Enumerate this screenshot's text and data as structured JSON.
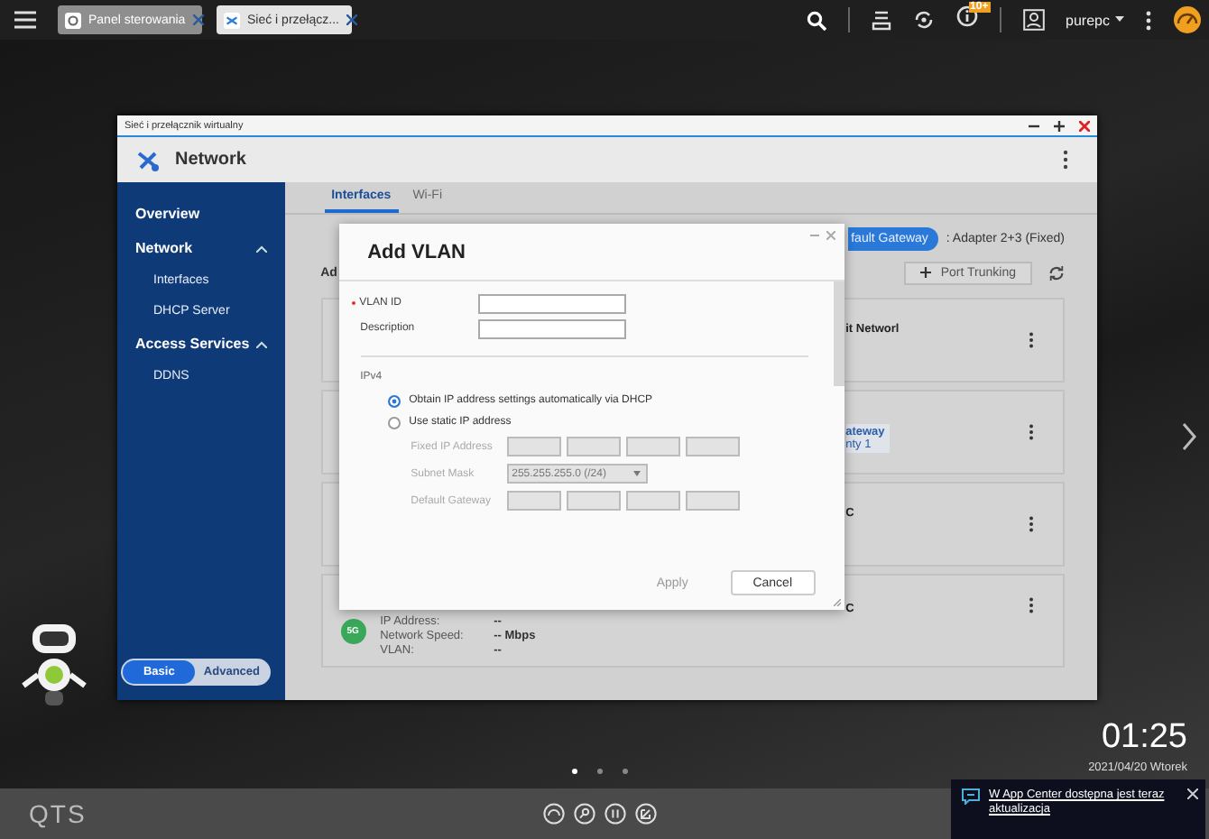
{
  "top_bar": {
    "tabs": [
      {
        "label": "Panel sterowania",
        "selected": false
      },
      {
        "label": "Sieć i przełącz...",
        "selected": true
      }
    ],
    "notification_badge": "10+",
    "user": "purepc"
  },
  "window": {
    "title": "Sieć i przełącznik wirtualny",
    "app_title": "Network"
  },
  "sidebar": {
    "items": [
      {
        "label": "Overview"
      },
      {
        "label": "Network",
        "expanded": true,
        "children": [
          {
            "label": "Interfaces"
          },
          {
            "label": "DHCP Server"
          }
        ]
      },
      {
        "label": "Access Services",
        "expanded": true,
        "children": [
          {
            "label": "DDNS"
          }
        ]
      }
    ],
    "mode_toggle": [
      {
        "label": "Basic",
        "selected": true
      },
      {
        "label": "Advanced",
        "selected": false
      }
    ]
  },
  "content": {
    "tabs": [
      {
        "label": "Interfaces",
        "selected": true
      },
      {
        "label": "Wi-Fi",
        "selected": false
      }
    ],
    "gateway_pill": "fault Gateway",
    "gateway_value": ": Adapter 2+3 (Fixed)",
    "section_fragment": "Ad",
    "port_trunking_button": "Port Trunking",
    "cards": [
      {
        "kind": "title",
        "fragment": "it Networl"
      },
      {
        "kind": "tag",
        "tag_lines": [
          "ateway",
          "nty 1"
        ]
      },
      {
        "kind": "title",
        "fragment": "C"
      },
      {
        "kind": "title",
        "fragment": "C",
        "badge": "5G",
        "details": [
          {
            "label": "IP Address:",
            "value": "--"
          },
          {
            "label": "Network Speed:",
            "value": "-- Mbps"
          },
          {
            "label": "VLAN:",
            "value": "--"
          }
        ]
      }
    ]
  },
  "dialog": {
    "title": "Add VLAN",
    "fields": [
      {
        "label": "VLAN ID",
        "required": true
      },
      {
        "label": "Description",
        "required": false
      }
    ],
    "section": "IPv4",
    "options": [
      {
        "label": "Obtain IP address settings automatically via DHCP",
        "selected": true
      },
      {
        "label": "Use static IP address",
        "selected": false
      }
    ],
    "static_rows": [
      {
        "label": "Fixed IP Address",
        "kind": "octets",
        "disabled": true
      },
      {
        "label": "Subnet Mask",
        "kind": "select",
        "value": "255.255.255.0 (/24)",
        "disabled": true
      },
      {
        "label": "Default Gateway",
        "kind": "octets",
        "disabled": true
      }
    ],
    "buttons": [
      {
        "label": "Apply",
        "disabled": true
      },
      {
        "label": "Cancel",
        "disabled": false
      }
    ]
  },
  "desktop": {
    "clock": "01:25",
    "date": "2021/04/20 Wtorek",
    "pager": [
      {
        "selected": true
      },
      {
        "selected": false
      },
      {
        "selected": false
      }
    ],
    "logo": "QTS",
    "notification": {
      "text": "W App Center dostępna jest teraz aktualizacja"
    }
  }
}
